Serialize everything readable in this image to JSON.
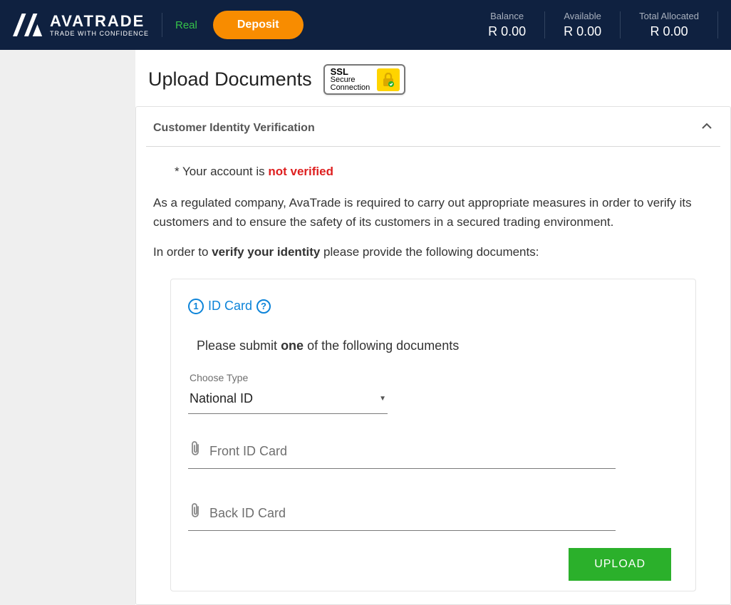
{
  "header": {
    "brand": "AVATRADE",
    "tagline": "TRADE WITH CONFIDENCE",
    "mode": "Real",
    "deposit_label": "Deposit",
    "stats": {
      "balance_label": "Balance",
      "balance_value": "R 0.00",
      "available_label": "Available",
      "available_value": "R 0.00",
      "allocated_label": "Total Allocated",
      "allocated_value": "R 0.00"
    }
  },
  "page": {
    "title": "Upload Documents",
    "ssl": {
      "l1": "SSL",
      "l2": "Secure",
      "l3": "Connection"
    }
  },
  "panel": {
    "title": "Customer Identity Verification",
    "status_prefix": "* Your account is ",
    "status_value": "not verified",
    "para1": "As a regulated company, AvaTrade is required to carry out appropriate measures in order to verify its customers and to ensure the safety of its customers in a secured trading environment.",
    "para2_pre": "In order to ",
    "para2_bold": "verify your identity",
    "para2_post": " please provide the following documents:"
  },
  "card": {
    "num": "1",
    "title": "ID Card",
    "help": "?",
    "sub_pre": "Please submit ",
    "sub_bold": "one",
    "sub_post": " of the following documents",
    "choose_label": "Choose Type",
    "choose_value": "National ID",
    "front_placeholder": "Front ID Card",
    "back_placeholder": "Back ID Card",
    "upload_label": "UPLOAD"
  }
}
